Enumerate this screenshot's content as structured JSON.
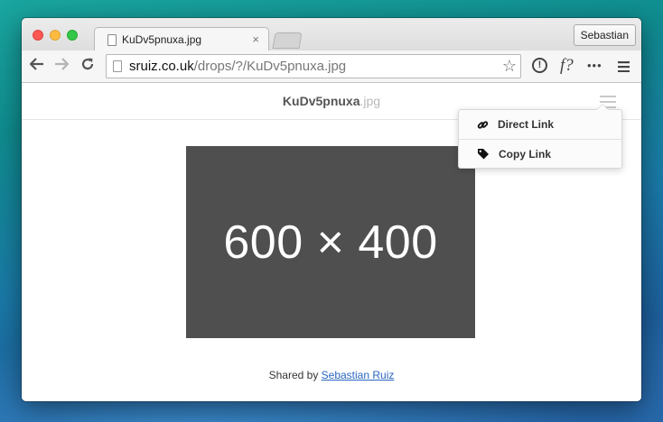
{
  "browser": {
    "tab_title": "KuDv5pnuxa.jpg",
    "tab_close": "×",
    "profile_name": "Sebastian",
    "url_host": "sruiz.co.uk",
    "url_path": "/drops/?/KuDv5pnuxa.jpg",
    "toolbar_ext_label": "f?",
    "toolbar_more": "•••"
  },
  "page": {
    "file_name": "KuDv5pnuxa",
    "file_ext": ".jpg",
    "image_placeholder_text": "600 × 400",
    "shared_by_prefix": "Shared by",
    "shared_by_name": "Sebastian Ruiz"
  },
  "menu": {
    "items": [
      {
        "label": "Direct Link",
        "icon": "link-icon"
      },
      {
        "label": "Copy Link",
        "icon": "tag-icon"
      }
    ]
  },
  "colors": {
    "link": "#2a66c0",
    "placeholder_bg": "#4f4f4f"
  }
}
